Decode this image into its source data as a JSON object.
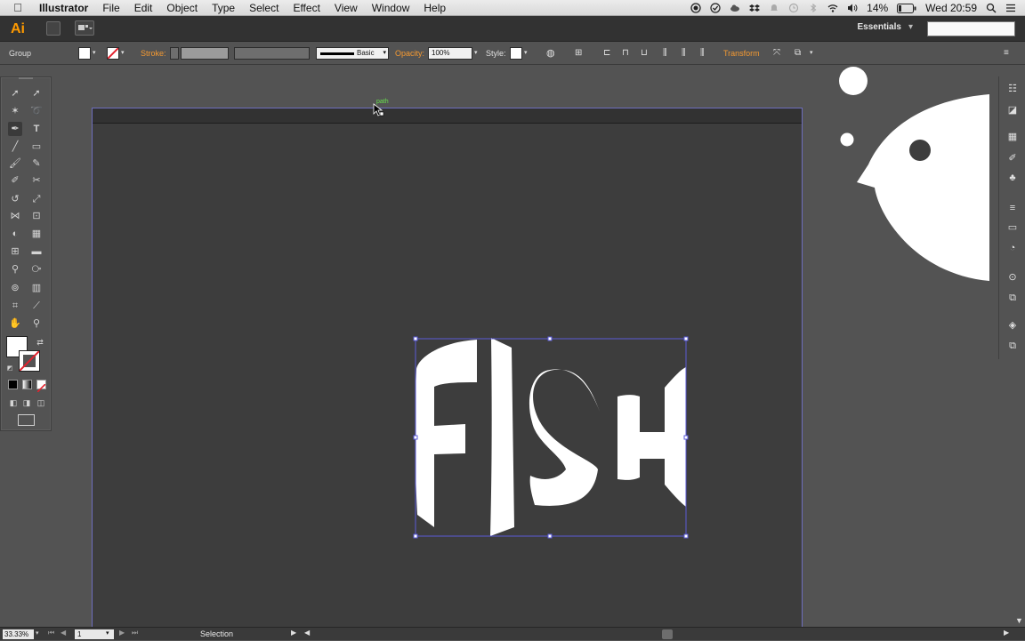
{
  "menubar": {
    "app_name": "Illustrator",
    "items": [
      "File",
      "Edit",
      "Object",
      "Type",
      "Select",
      "Effect",
      "View",
      "Window",
      "Help"
    ],
    "battery": "14%",
    "clock": "Wed 20:59"
  },
  "appbar": {
    "logo": "Ai",
    "workspace": "Essentials",
    "workspace_chevron": "▾",
    "search_placeholder": ""
  },
  "controlbar": {
    "selection_type": "Group",
    "stroke_label": "Stroke:",
    "stroke_profile": "Basic",
    "opacity_label": "Opacity:",
    "opacity_value": "100%",
    "style_label": "Style:",
    "transform_label": "Transform"
  },
  "canvas": {
    "smart_guide_label": "path",
    "artwork_text": "FISH"
  },
  "statusbar": {
    "zoom": "33.33%",
    "page": "1",
    "mode": "Selection"
  },
  "colors": {
    "accent_orange": "#f59a32",
    "artboard": "#3d3d3d",
    "selection_blue": "#5a5ad8",
    "smart_guide_green": "#67e04d",
    "artwork_white": "#ffffff"
  },
  "icons": {
    "menubar_right": [
      "record-icon",
      "checkmark-circle-icon",
      "cloud-icon",
      "dropbox-icon",
      "notification-bell-icon",
      "time-machine-icon",
      "bluetooth-icon",
      "wifi-icon",
      "volume-icon",
      "search-icon",
      "list-icon"
    ],
    "tools": [
      "selection-tool-icon",
      "direct-selection-tool-icon",
      "magic-wand-tool-icon",
      "lasso-tool-icon",
      "pen-tool-icon",
      "type-tool-icon",
      "line-tool-icon",
      "rectangle-tool-icon",
      "paintbrush-tool-icon",
      "pencil-tool-icon",
      "blob-brush-tool-icon",
      "eraser-tool-icon",
      "rotate-tool-icon",
      "scale-tool-icon",
      "width-tool-icon",
      "free-transform-tool-icon",
      "shape-builder-tool-icon",
      "perspective-grid-tool-icon",
      "mesh-tool-icon",
      "gradient-tool-icon",
      "eyedropper-tool-icon",
      "blend-tool-icon",
      "symbol-sprayer-tool-icon",
      "column-graph-tool-icon",
      "artboard-tool-icon",
      "slice-tool-icon",
      "hand-tool-icon",
      "zoom-tool-icon"
    ]
  }
}
